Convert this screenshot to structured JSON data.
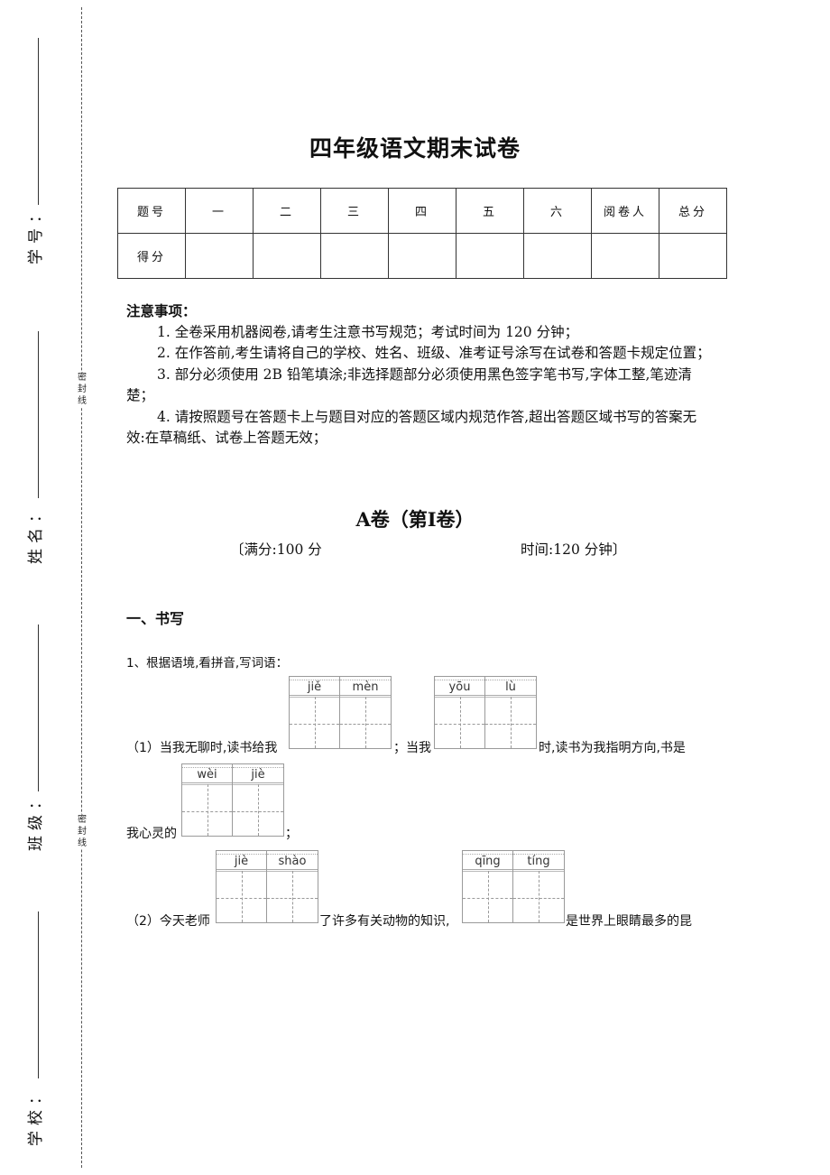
{
  "margin": {
    "fields": [
      {
        "label": "学号：",
        "key": "student-id"
      },
      {
        "label": "姓名：",
        "key": "name"
      },
      {
        "label": "班级：",
        "key": "class"
      },
      {
        "label": "学校：",
        "key": "school"
      }
    ],
    "seal_text": [
      "密",
      "封",
      "线"
    ]
  },
  "title": "四年级语文期末试卷",
  "score_table": {
    "header": [
      "题号",
      "一",
      "二",
      "三",
      "四",
      "五",
      "六",
      "阅卷人",
      "总分"
    ],
    "row_label": "得分",
    "scores": [
      "",
      "",
      "",
      "",
      "",
      "",
      "",
      ""
    ]
  },
  "notes": {
    "heading": "注意事项：",
    "items": [
      "1. 全卷采用机器阅卷,请考生注意书写规范；考试时间为 120 分钟；",
      "2. 在作答前,考生请将自己的学校、姓名、班级、准考证号涂写在试卷和答题卡规定位置；",
      "3. 部分必须使用 2B 铅笔填涂;非选择题部分必须使用黑色签字笔书写,字体工整,笔迹清楚；",
      "4. 请按照题号在答题卡上与题目对应的答题区域内规范作答,超出答题区域书写的答案无效:在草稿纸、试卷上答题无效；"
    ]
  },
  "section_a": {
    "title": "A卷（第Ⅰ卷）",
    "full_score": "〔满分:100 分",
    "time": "时间:120 分钟〕"
  },
  "part1": {
    "title": "一、书写",
    "question": "1、根据语境,看拼音,写词语：",
    "sub1": {
      "text_a": "（1）当我无聊时,读书给我",
      "text_b": "；当我",
      "text_c": "时,读书为我指明方向,书是",
      "text_d": "我心灵的",
      "text_e": "；",
      "pinyin_1": [
        "jiě",
        "mèn"
      ],
      "pinyin_2": [
        "yōu",
        "lù"
      ],
      "pinyin_3": [
        "wèi",
        "jiè"
      ]
    },
    "sub2": {
      "text_a": "（2）今天老师",
      "text_b": "了许多有关动物的知识,",
      "text_c": "是世界上眼睛最多的昆",
      "pinyin_1": [
        "jiè",
        "shào"
      ],
      "pinyin_2": [
        "qīng",
        "tíng"
      ]
    }
  }
}
